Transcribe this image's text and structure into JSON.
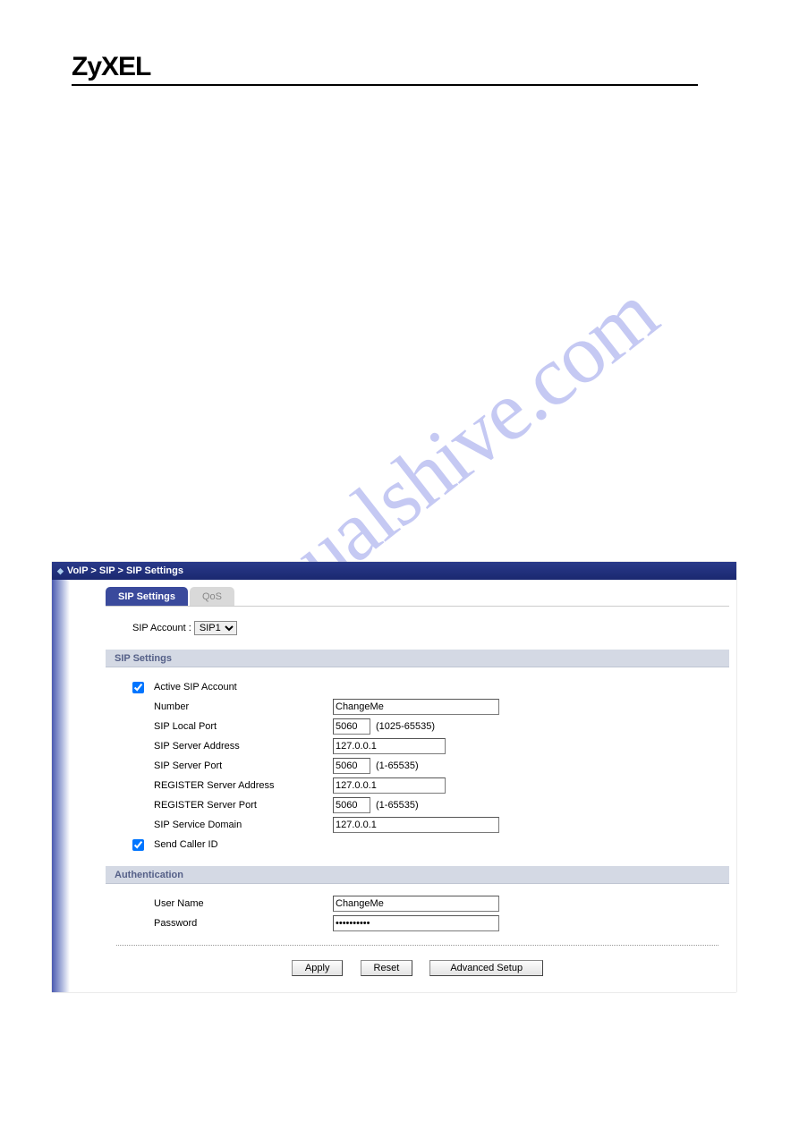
{
  "brand": "ZyXEL",
  "watermark": "manualshive.com",
  "titlebar": {
    "path": "VoIP > SIP > SIP Settings"
  },
  "tabs": {
    "active": "SIP Settings",
    "inactive": "QoS"
  },
  "account": {
    "label": "SIP Account :",
    "selected": "SIP1"
  },
  "sections": {
    "sip_settings_header": "SIP Settings",
    "auth_header": "Authentication"
  },
  "sip": {
    "active_label": "Active SIP Account",
    "active_checked": true,
    "number_label": "Number",
    "number_value": "ChangeMe",
    "local_port_label": "SIP Local Port",
    "local_port_value": "5060",
    "local_port_note": "(1025-65535)",
    "server_addr_label": "SIP Server Address",
    "server_addr_value": "127.0.0.1",
    "server_port_label": "SIP Server Port",
    "server_port_value": "5060",
    "server_port_note": "(1-65535)",
    "reg_addr_label": "REGISTER Server Address",
    "reg_addr_value": "127.0.0.1",
    "reg_port_label": "REGISTER Server Port",
    "reg_port_value": "5060",
    "reg_port_note": "(1-65535)",
    "domain_label": "SIP Service Domain",
    "domain_value": "127.0.0.1",
    "caller_id_label": "Send Caller ID",
    "caller_id_checked": true
  },
  "auth": {
    "user_label": "User Name",
    "user_value": "ChangeMe",
    "pass_label": "Password",
    "pass_value": "••••••••••"
  },
  "buttons": {
    "apply": "Apply",
    "reset": "Reset",
    "advanced": "Advanced Setup"
  }
}
